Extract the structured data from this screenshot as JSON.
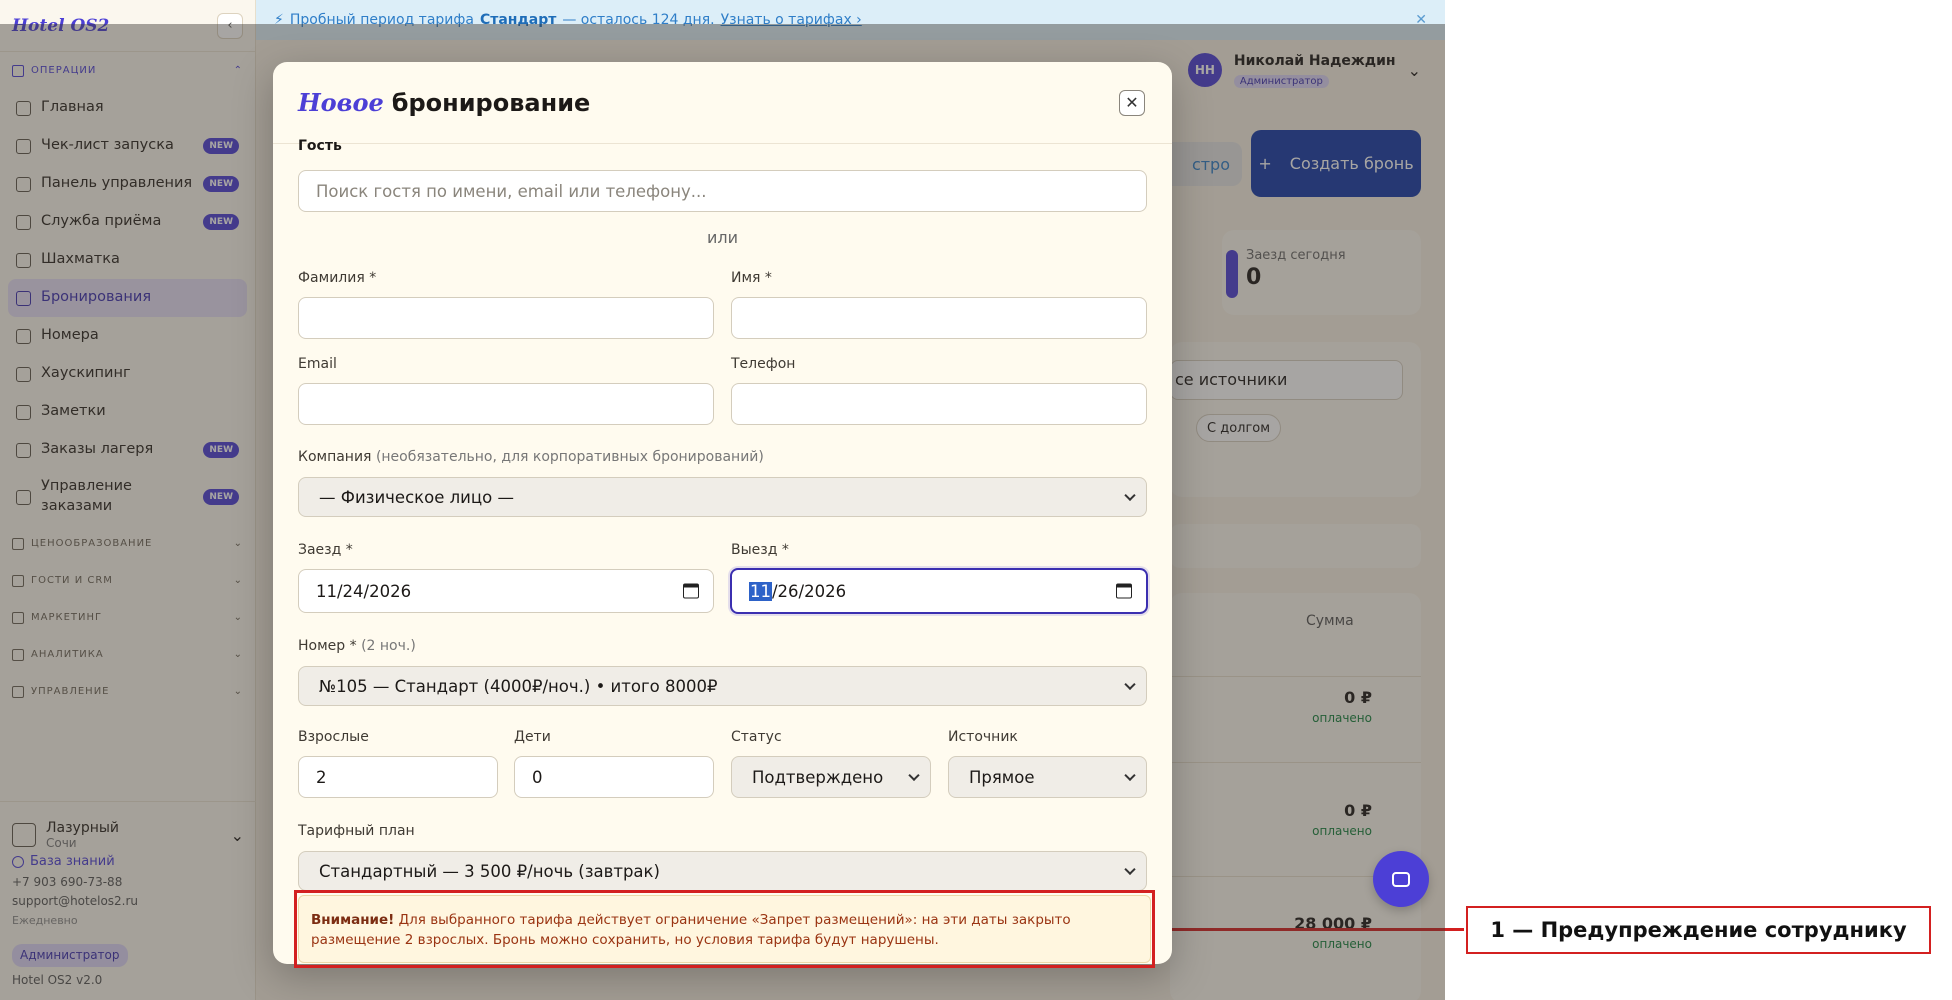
{
  "app": {
    "brand": "Hotel OS2",
    "trial_banner": {
      "text_prefix": "Пробный период тарифа",
      "plan": "Стандарт",
      "text_suffix": "— осталось 124 дня.",
      "link": "Узнать о тарифах ›"
    },
    "user": {
      "initials": "НН",
      "name": "Николай Надеждин",
      "role": "Администратор"
    },
    "sidebar": {
      "section_operations": "Операции",
      "items": [
        {
          "label": "Главная",
          "badge": ""
        },
        {
          "label": "Чек-лист запуска",
          "badge": "NEW"
        },
        {
          "label": "Панель управления",
          "badge": "NEW"
        },
        {
          "label": "Служба приёма",
          "badge": "NEW"
        },
        {
          "label": "Шахматка",
          "badge": ""
        },
        {
          "label": "Бронирования",
          "badge": ""
        },
        {
          "label": "Номера",
          "badge": ""
        },
        {
          "label": "Хаускипинг",
          "badge": ""
        },
        {
          "label": "Заметки",
          "badge": ""
        },
        {
          "label": "Заказы лагеря",
          "badge": "NEW"
        },
        {
          "label": "Управление заказами",
          "badge": "NEW"
        }
      ],
      "sections": [
        "Ценообразование",
        "Гости и CRM",
        "Маркетинг",
        "Аналитика",
        "Управление"
      ],
      "hotel": {
        "name": "Лазурный",
        "city": "Сочи"
      },
      "footer": {
        "knowledge_base": "База знаний",
        "phone": "+7 903 690-73-88",
        "email": "support@hotelos2.ru",
        "hours": "Ежедневно",
        "role": "Администратор",
        "version": "Hotel OS2 v2.0"
      }
    },
    "page": {
      "btn_fast": "стро",
      "btn_create": "Создать бронь",
      "stat_checkin_label": "Заезд сегодня",
      "stat_checkin_value": "0",
      "filter_source": "се источники",
      "filter_chip": "С долгом",
      "table_sum_header": "Сумма",
      "rows": [
        {
          "amount": "0 ₽",
          "status": "оплачено"
        },
        {
          "amount": "0 ₽",
          "status": "оплачено"
        },
        {
          "amount": "28 000 ₽",
          "status": "оплачено"
        }
      ]
    }
  },
  "modal": {
    "title_accent": "Новое",
    "title_rest": "бронирование",
    "guest_label": "Гость",
    "guest_search_placeholder": "Поиск гостя по имени, email или телефону...",
    "or": "или",
    "last_name_label": "Фамилия *",
    "first_name_label": "Имя *",
    "email_label": "Email",
    "phone_label": "Телефон",
    "company_label": "Компания",
    "company_hint": "(необязательно, для корпоративных бронирований)",
    "company_value": "— Физическое лицо —",
    "checkin_label": "Заезд *",
    "checkin_value": "11/24/2026",
    "checkout_label": "Выезд *",
    "checkout_month": "11",
    "checkout_rest": "/26/2026",
    "room_label": "Номер *",
    "room_nights": "(2 ноч.)",
    "room_value": "№105 — Стандарт (4000₽/ноч.) • итого 8000₽",
    "adults_label": "Взрослые",
    "adults_value": "2",
    "children_label": "Дети",
    "children_value": "0",
    "status_label": "Статус",
    "status_value": "Подтверждено",
    "source_label": "Источник",
    "source_value": "Прямое",
    "tariff_label": "Тарифный план",
    "tariff_value": "Стандартный — 3 500 ₽/ночь (завтрак)",
    "warning_bold": "Внимание!",
    "warning_text": "Для выбранного тарифа действует ограничение «Запрет размещений»: на эти даты закрыто размещение 2 взрослых. Бронь можно сохранить, но условия тарифа будут нарушены."
  },
  "annotation": {
    "label": "1 — Предупреждение сотруднику",
    "color": "#d32020"
  }
}
